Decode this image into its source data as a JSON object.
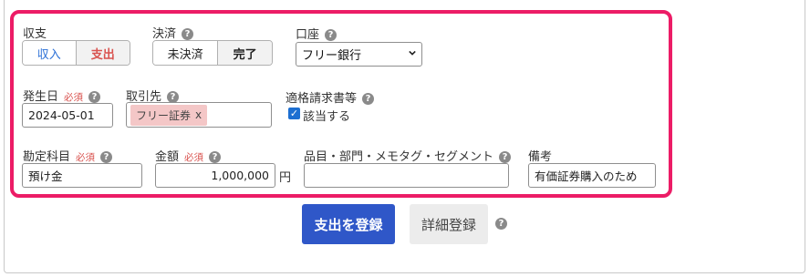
{
  "balance": {
    "label": "収支",
    "options": [
      "収入",
      "支出"
    ],
    "selected": "支出"
  },
  "settlement": {
    "label": "決済",
    "options": [
      "未決済",
      "完了"
    ],
    "selected": "完了"
  },
  "account": {
    "label": "口座",
    "value": "フリー銀行"
  },
  "issue_date": {
    "label": "発生日",
    "required": "必須",
    "value": "2024-05-01"
  },
  "partner": {
    "label": "取引先",
    "tag": "フリー証券",
    "tag_remove": "x"
  },
  "qualified_invoice": {
    "label": "適格請求書等",
    "checkbox_label": "該当する",
    "checked": true
  },
  "account_item": {
    "label": "勘定科目",
    "required": "必須",
    "value": "預け金"
  },
  "amount": {
    "label": "金額",
    "required": "必須",
    "value": "1,000,000",
    "unit": "円"
  },
  "tags": {
    "label": "品目・部門・メモタグ・セグメント",
    "value": ""
  },
  "note": {
    "label": "備考",
    "value": "有価証券購入のため"
  },
  "actions": {
    "register_label": "支出を登録",
    "detail_label": "詳細登録"
  },
  "help_symbol": "?",
  "colors": {
    "highlight": "#ec1c66",
    "primary": "#2f57c8",
    "expense_active": "#d9534f",
    "income": "#2a6fd6"
  }
}
